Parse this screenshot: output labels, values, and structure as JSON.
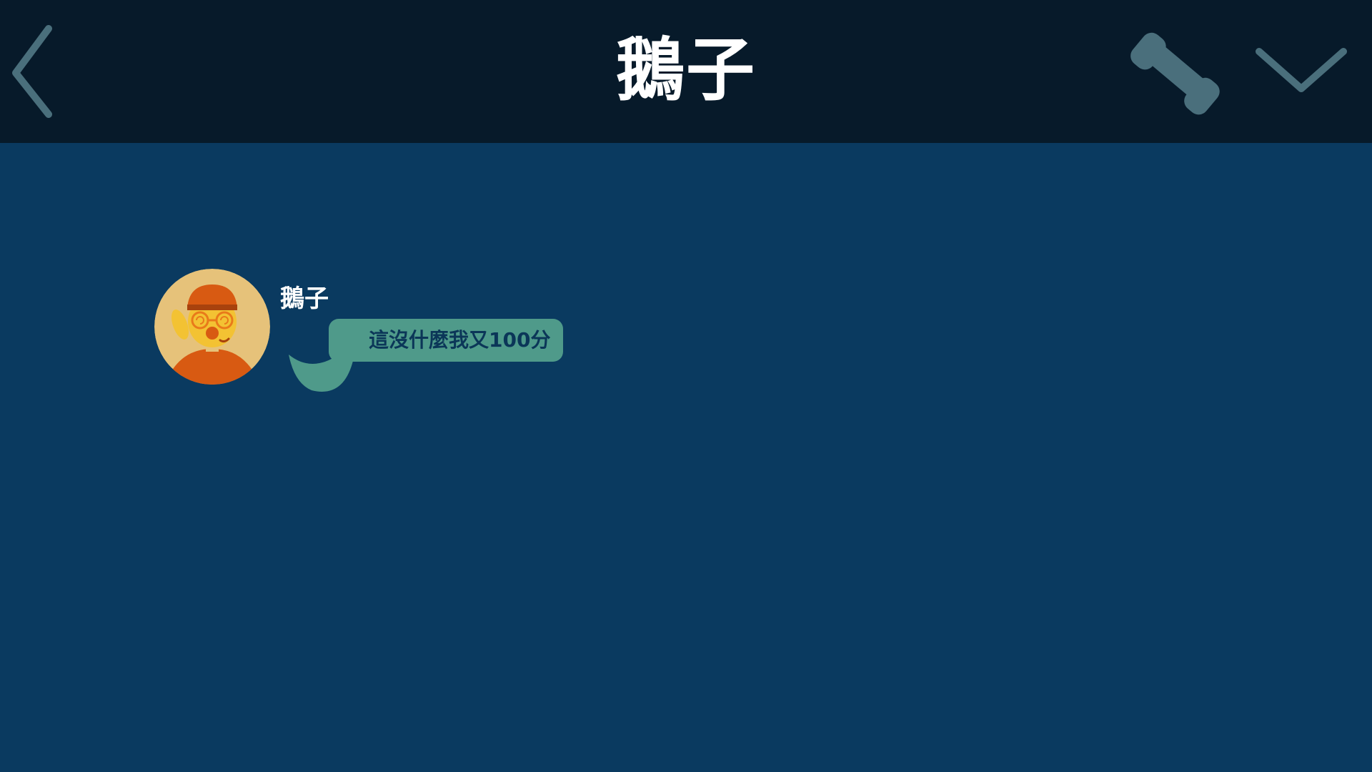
{
  "header": {
    "title": "鵝子",
    "back_icon": "chevron-left-icon",
    "call_icon": "phone-icon",
    "dropdown_icon": "chevron-down-icon"
  },
  "colors": {
    "header_bg": "#071a2a",
    "chat_bg": "#0a3a60",
    "icon_color": "#4a6f7c",
    "bubble_bg": "#4f9a8a",
    "bubble_text": "#0b3658",
    "avatar_bg": "#e6c27a",
    "avatar_accent": "#d85a12"
  },
  "messages": [
    {
      "sender": "鵝子",
      "avatar_icon": "cartoon-face-avatar",
      "text": "這沒什麼我又100分"
    }
  ]
}
